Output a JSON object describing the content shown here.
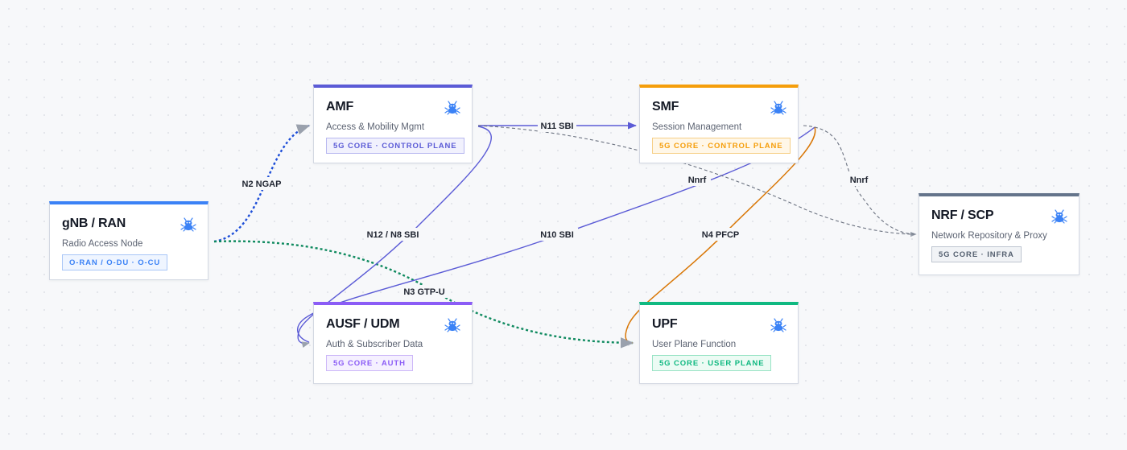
{
  "colors": {
    "blue": "#3b82f6",
    "indigo": "#5b5bd6",
    "purple": "#8b5cf6",
    "orange": "#f59e0b",
    "green": "#10b981",
    "slate": "#64748b",
    "edge_orange": "#d97706",
    "edge_gray": "#6b7280",
    "edge_green": "#0f8a5f",
    "edge_blue": "#1d4ed8"
  },
  "nodes": {
    "gnb": {
      "title": "gNB / RAN",
      "subtitle": "Radio Access Node",
      "tag": "O-RAN / O-DU · O-CU",
      "icon": "ant-robot-icon"
    },
    "amf": {
      "title": "AMF",
      "subtitle": "Access & Mobility Mgmt",
      "tag": "5G CORE · CONTROL PLANE",
      "icon": "ant-robot-icon"
    },
    "smf": {
      "title": "SMF",
      "subtitle": "Session Management",
      "tag": "5G CORE · CONTROL PLANE",
      "icon": "ant-robot-icon"
    },
    "nrf": {
      "title": "NRF / SCP",
      "subtitle": "Network Repository & Proxy",
      "tag": "5G CORE · INFRA",
      "icon": "ant-robot-icon"
    },
    "ausf": {
      "title": "AUSF / UDM",
      "subtitle": "Auth & Subscriber Data",
      "tag": "5G CORE · AUTH",
      "icon": "ant-robot-icon"
    },
    "upf": {
      "title": "UPF",
      "subtitle": "User Plane Function",
      "tag": "5G CORE · USER PLANE",
      "icon": "ant-robot-icon"
    }
  },
  "edges": {
    "n2": {
      "label": "N2 NGAP"
    },
    "n3": {
      "label": "N3 GTP-U"
    },
    "n11": {
      "label": "N11 SBI"
    },
    "n12": {
      "label": "N12 / N8 SBI"
    },
    "n10": {
      "label": "N10 SBI"
    },
    "n4": {
      "label": "N4 PFCP"
    },
    "nnrf_amf": {
      "label": "Nnrf"
    },
    "nnrf_smf": {
      "label": "Nnrf"
    }
  }
}
